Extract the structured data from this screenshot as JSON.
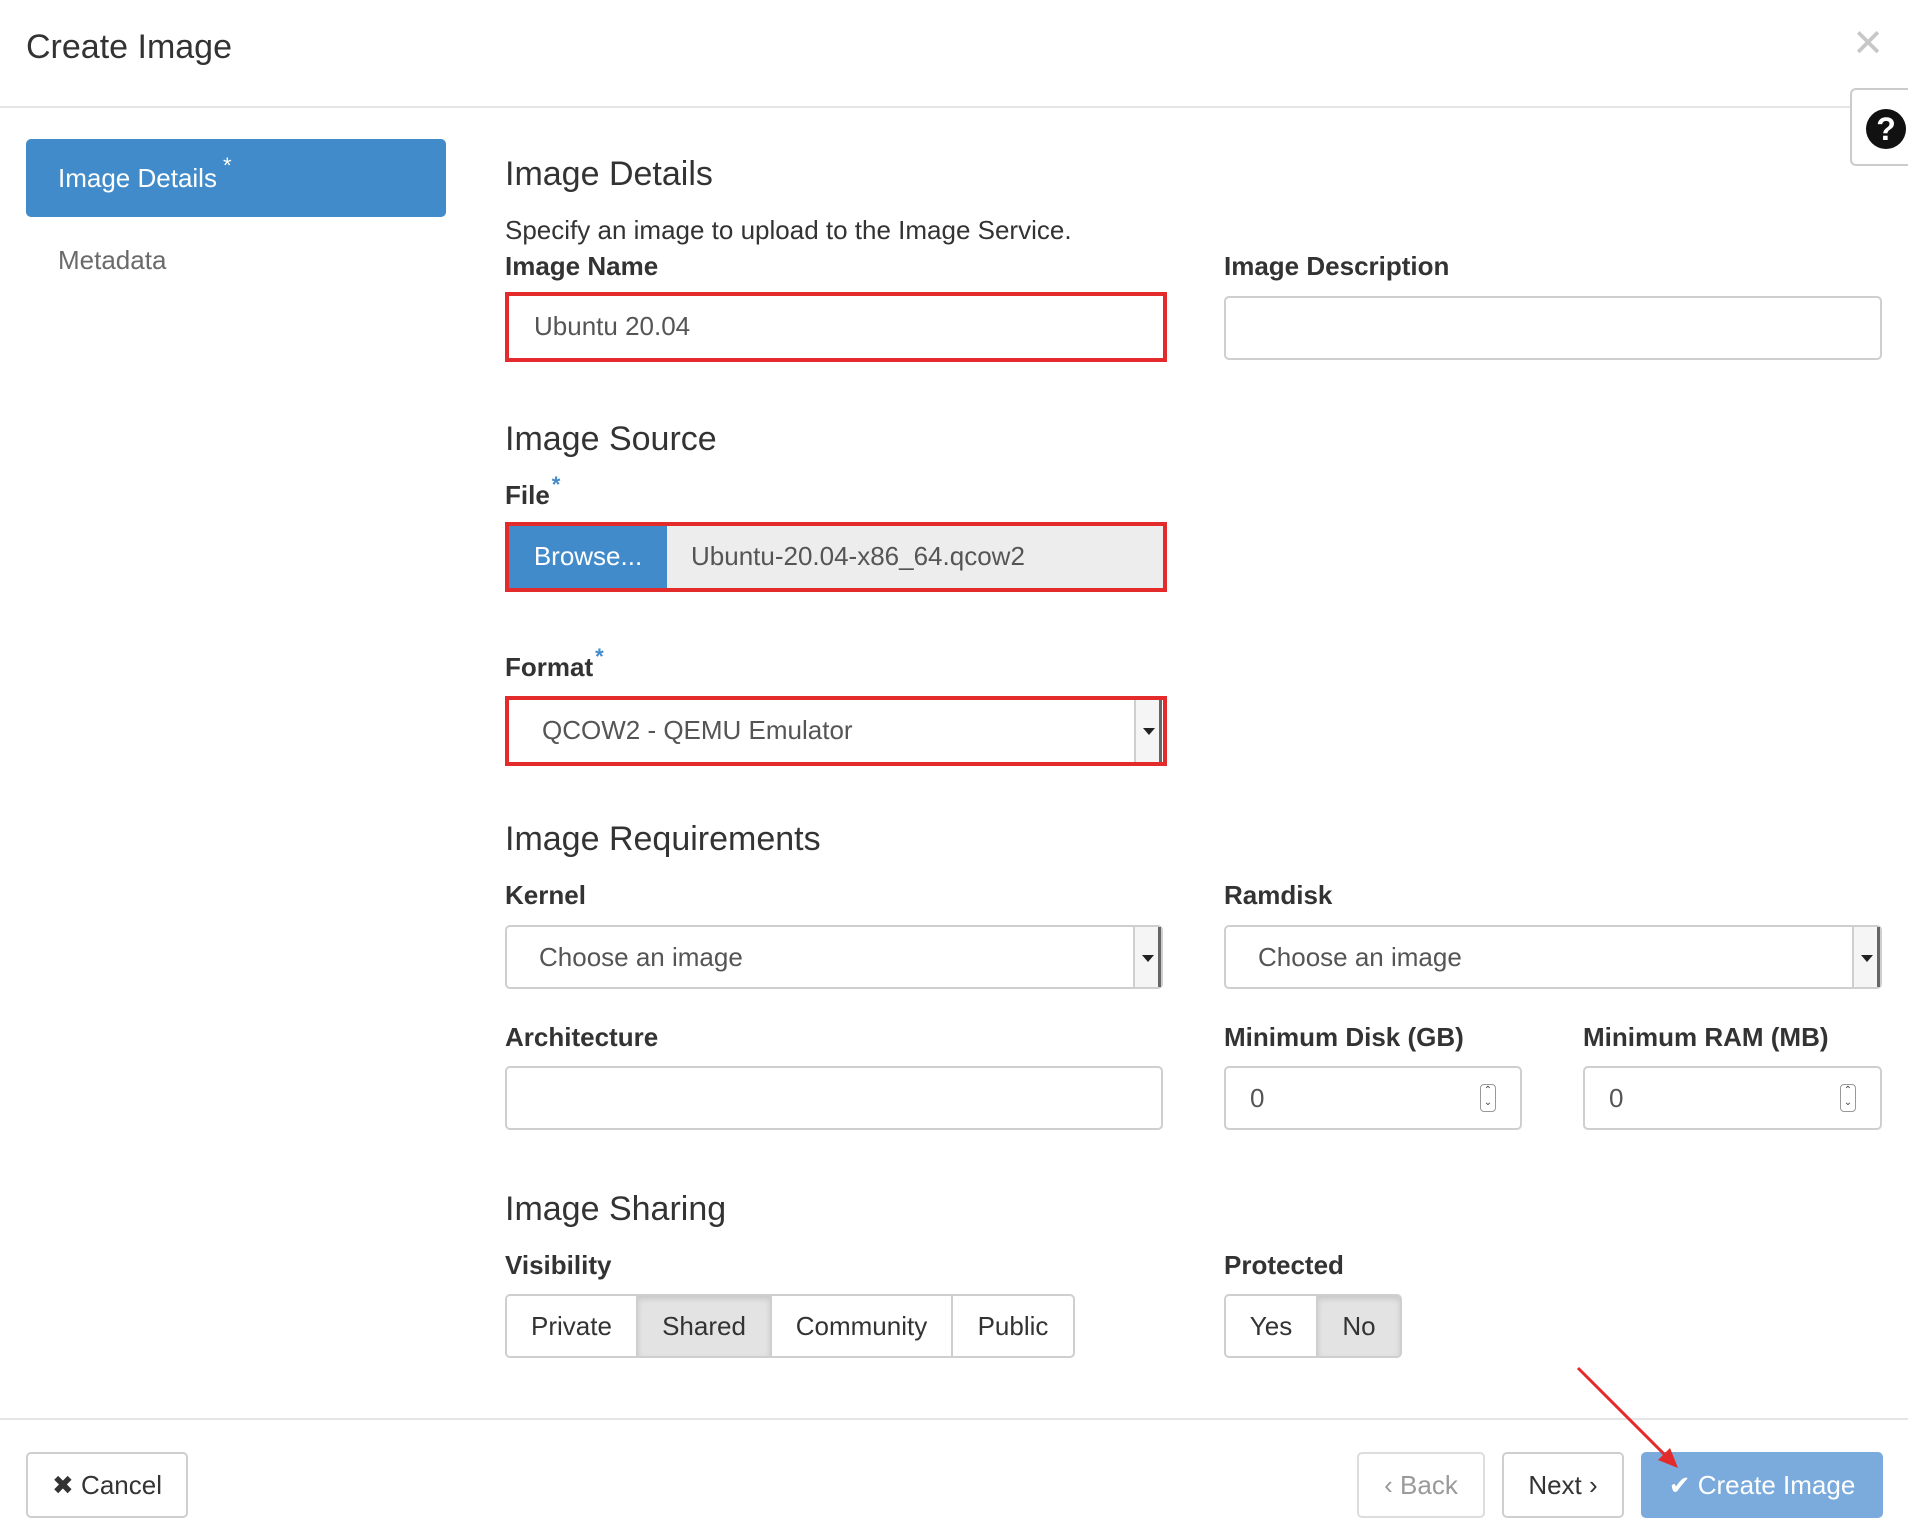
{
  "modal": {
    "title": "Create Image",
    "close_icon": "close-icon",
    "help_icon": "help-icon"
  },
  "sidebar": {
    "items": [
      {
        "label": "Image Details",
        "required_mark": "*",
        "active": true
      },
      {
        "label": "Metadata",
        "active": false
      }
    ]
  },
  "details": {
    "heading": "Image Details",
    "help": "Specify an image to upload to the Image Service.",
    "name_label": "Image Name",
    "name_value": "Ubuntu 20.04",
    "description_label": "Image Description",
    "description_value": ""
  },
  "source": {
    "heading": "Image Source",
    "file_label": "File",
    "file_required": "*",
    "browse_label": "Browse...",
    "file_name": "Ubuntu-20.04-x86_64.qcow2",
    "format_label": "Format",
    "format_required": "*",
    "format_value": "QCOW2 - QEMU Emulator"
  },
  "requirements": {
    "heading": "Image Requirements",
    "kernel_label": "Kernel",
    "kernel_value": "Choose an image",
    "ramdisk_label": "Ramdisk",
    "ramdisk_value": "Choose an image",
    "architecture_label": "Architecture",
    "architecture_value": "",
    "min_disk_label": "Minimum Disk (GB)",
    "min_disk_value": "0",
    "min_ram_label": "Minimum RAM (MB)",
    "min_ram_value": "0"
  },
  "sharing": {
    "heading": "Image Sharing",
    "visibility_label": "Visibility",
    "visibility_options": [
      "Private",
      "Shared",
      "Community",
      "Public"
    ],
    "visibility_selected": "Shared",
    "protected_label": "Protected",
    "protected_options": [
      "Yes",
      "No"
    ],
    "protected_selected": "No"
  },
  "footer": {
    "cancel_label": "Cancel",
    "back_label": "Back",
    "next_label": "Next",
    "create_label": "Create Image"
  },
  "colors": {
    "primary": "#428bca",
    "highlight": "#e32b2b"
  }
}
